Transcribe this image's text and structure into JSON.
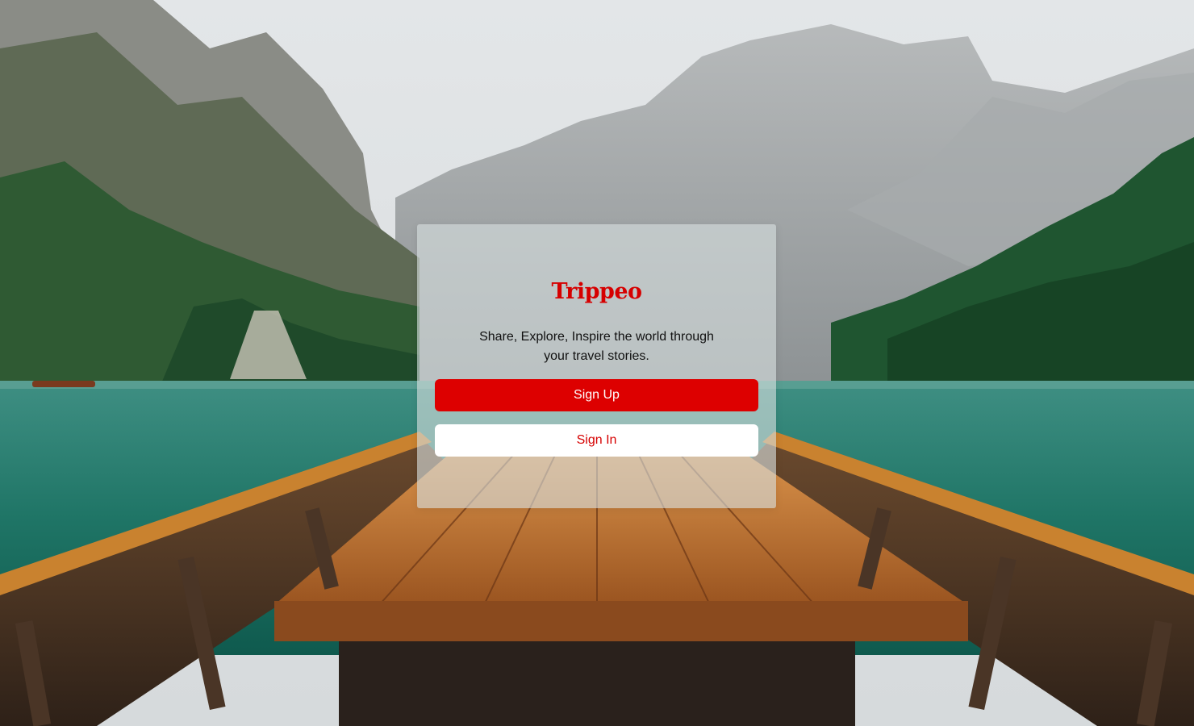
{
  "brand": {
    "name": "Trippeo",
    "color": "#d60000"
  },
  "tagline": "Share, Explore, Inspire the world through your travel stories.",
  "actions": {
    "sign_up_label": "Sign Up",
    "sign_in_label": "Sign In"
  },
  "colors": {
    "accent": "#dd0000",
    "secondary_button_bg": "#ffffff"
  }
}
